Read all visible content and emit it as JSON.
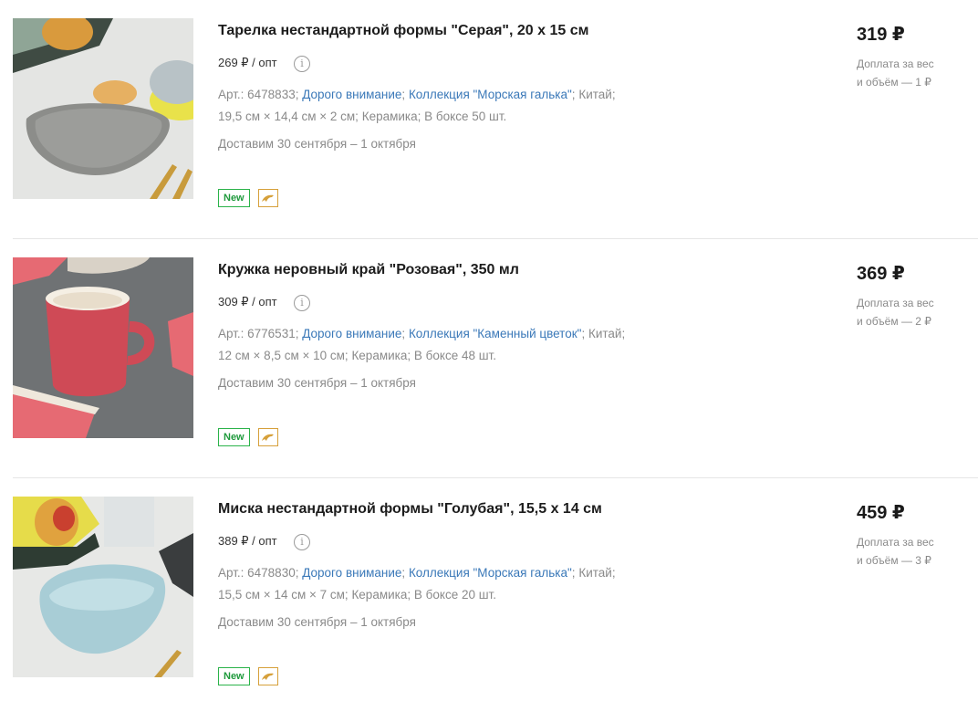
{
  "products": [
    {
      "title": "Тарелка нестандартной формы \"Серая\", 20 х 15 см",
      "wholesale_price": "269 ₽ / опт",
      "article": "Арт.: 6478833;",
      "brand_link": "Дорого внимание",
      "collection_link": "Коллекция \"Морская галька\"",
      "country": "Китай;",
      "dimensions": "19,5 см × 14,4 см × 2 см;",
      "material": "Керамика;",
      "box": "В боксе 50 шт.",
      "delivery": "Доставим 30 сентября – 1 октября",
      "badge": "New",
      "price": "319 ₽",
      "surcharge_line1": "Доплата за вес",
      "surcharge_line2": "и объём — 1 ₽"
    },
    {
      "title": "Кружка неровный край \"Розовая\", 350 мл",
      "wholesale_price": "309 ₽ / опт",
      "article": "Арт.: 6776531;",
      "brand_link": "Дорого внимание",
      "collection_link": "Коллекция \"Каменный цветок\"",
      "country": "Китай;",
      "dimensions": "12 см × 8,5 см × 10 см;",
      "material": "Керамика;",
      "box": "В боксе 48 шт.",
      "delivery": "Доставим 30 сентября – 1 октября",
      "badge": "New",
      "price": "369 ₽",
      "surcharge_line1": "Доплата за вес",
      "surcharge_line2": "и объём — 2 ₽"
    },
    {
      "title": "Миска нестандартной формы \"Голубая\", 15,5 х 14 см",
      "wholesale_price": "389 ₽ / опт",
      "article": "Арт.: 6478830;",
      "brand_link": "Дорого внимание",
      "collection_link": "Коллекция \"Морская галька\"",
      "country": "Китай;",
      "dimensions": "15,5 см × 14 см × 7 см;",
      "material": "Керамика;",
      "box": "В боксе 20 шт.",
      "delivery": "Доставим 30 сентября – 1 октября",
      "badge": "New",
      "price": "459 ₽",
      "surcharge_line1": "Доплата за вес",
      "surcharge_line2": "и объём — 3 ₽"
    }
  ],
  "icons": {
    "info": "info-icon",
    "brand_badge": "dolphin-icon"
  },
  "colors": {
    "link": "#3a78b8",
    "badge_new": "#2bb34a",
    "badge_brand": "#d6a03a",
    "muted_text": "#8a8a8a"
  }
}
